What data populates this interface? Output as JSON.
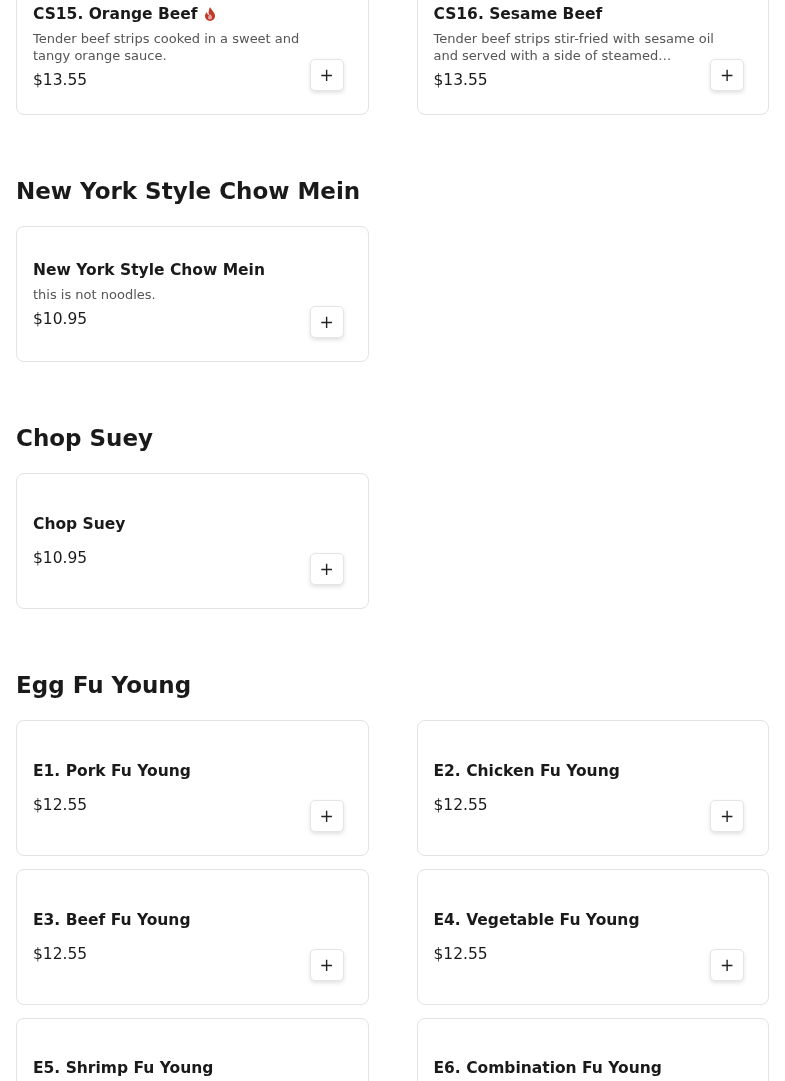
{
  "sections": [
    {
      "items": [
        {
          "name": "CS15. Orange Beef",
          "spicy": true,
          "description": "Tender beef strips cooked in a sweet and tangy orange sauce.",
          "price": "$13.55",
          "add_button": "+"
        },
        {
          "name": "CS16. Sesame Beef",
          "spicy": false,
          "description": "Tender beef strips stir-fried with sesame oil and served with a side of steamed…",
          "price": "$13.55",
          "add_button": "+"
        }
      ]
    },
    {
      "title": "New York Style Chow Mein",
      "items": [
        {
          "name": "New York Style Chow Mein",
          "spicy": false,
          "description": "this is not noodles.",
          "price": "$10.95",
          "add_button": "+"
        }
      ]
    },
    {
      "title": "Chop Suey",
      "items": [
        {
          "name": "Chop Suey",
          "spicy": false,
          "price": "$10.95",
          "add_button": "+"
        }
      ]
    },
    {
      "title": "Egg Fu Young",
      "items": [
        {
          "name": "E1. Pork Fu Young",
          "spicy": false,
          "price": "$12.55",
          "add_button": "+"
        },
        {
          "name": "E2. Chicken Fu Young",
          "spicy": false,
          "price": "$12.55",
          "add_button": "+"
        },
        {
          "name": "E3. Beef Fu Young",
          "spicy": false,
          "price": "$12.55",
          "add_button": "+"
        },
        {
          "name": "E4. Vegetable Fu Young",
          "spicy": false,
          "price": "$12.55",
          "add_button": "+"
        },
        {
          "name": "E5. Shrimp Fu Young",
          "spicy": false
        },
        {
          "name": "E6. Combination Fu Young",
          "spicy": false
        }
      ]
    }
  ]
}
